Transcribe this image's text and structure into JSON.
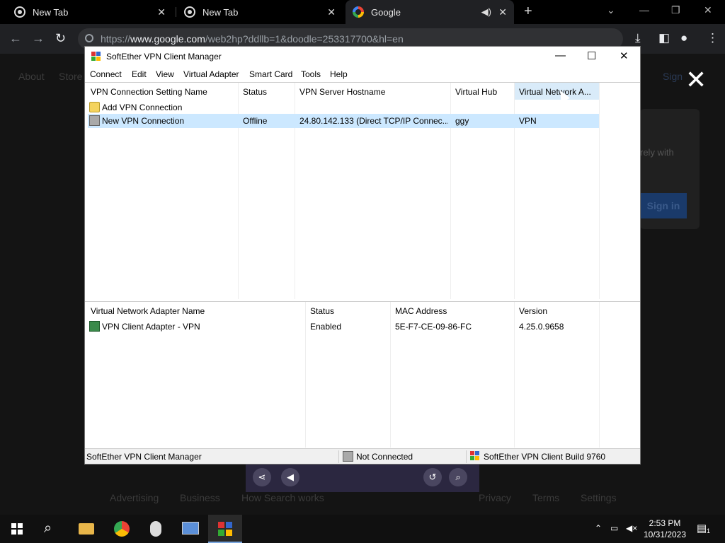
{
  "browser": {
    "tabs": [
      {
        "label": "New Tab",
        "active": false
      },
      {
        "label": "New Tab",
        "active": false
      },
      {
        "label": "Google",
        "active": true
      }
    ],
    "url_prefix": "https://",
    "url_host": "www.google.com",
    "url_path": "/web2hp?ddllb=1&doodle=253317700&hl=en"
  },
  "page": {
    "links_top": [
      "About",
      "Store"
    ],
    "signin_partial": "Sign",
    "card_text": "rely with",
    "signin_button": "Sign in",
    "footer_left": [
      "Advertising",
      "Business",
      "How Search works"
    ],
    "footer_right": [
      "Privacy",
      "Terms",
      "Settings"
    ]
  },
  "vpn": {
    "title": "SoftEther VPN Client Manager",
    "menu": [
      "Connect",
      "Edit",
      "View",
      "Virtual Adapter",
      "Smart Card",
      "Tools",
      "Help"
    ],
    "connections": {
      "columns": [
        "VPN Connection Setting Name",
        "Status",
        "VPN Server Hostname",
        "Virtual Hub",
        "Virtual Network A..."
      ],
      "rows": [
        {
          "name": "Add VPN Connection",
          "status": "",
          "host": "",
          "hub": "",
          "adapter": "",
          "selected": false
        },
        {
          "name": "New VPN Connection",
          "status": "Offline",
          "host": "24.80.142.133 (Direct TCP/IP Connec...",
          "hub": "ggy",
          "adapter": "VPN",
          "selected": true
        }
      ]
    },
    "adapters": {
      "columns": [
        "Virtual Network Adapter Name",
        "Status",
        "MAC Address",
        "Version"
      ],
      "rows": [
        {
          "name": "VPN Client Adapter - VPN",
          "status": "Enabled",
          "mac": "5E-F7-CE-09-86-FC",
          "version": "4.25.0.9658"
        }
      ]
    },
    "statusbar": {
      "app": "SoftEther VPN Client Manager",
      "connection": "Not Connected",
      "build": "SoftEther VPN Client Build 9760"
    }
  },
  "taskbar": {
    "time": "2:53 PM",
    "date": "10/31/2023",
    "notification_count": "1"
  }
}
